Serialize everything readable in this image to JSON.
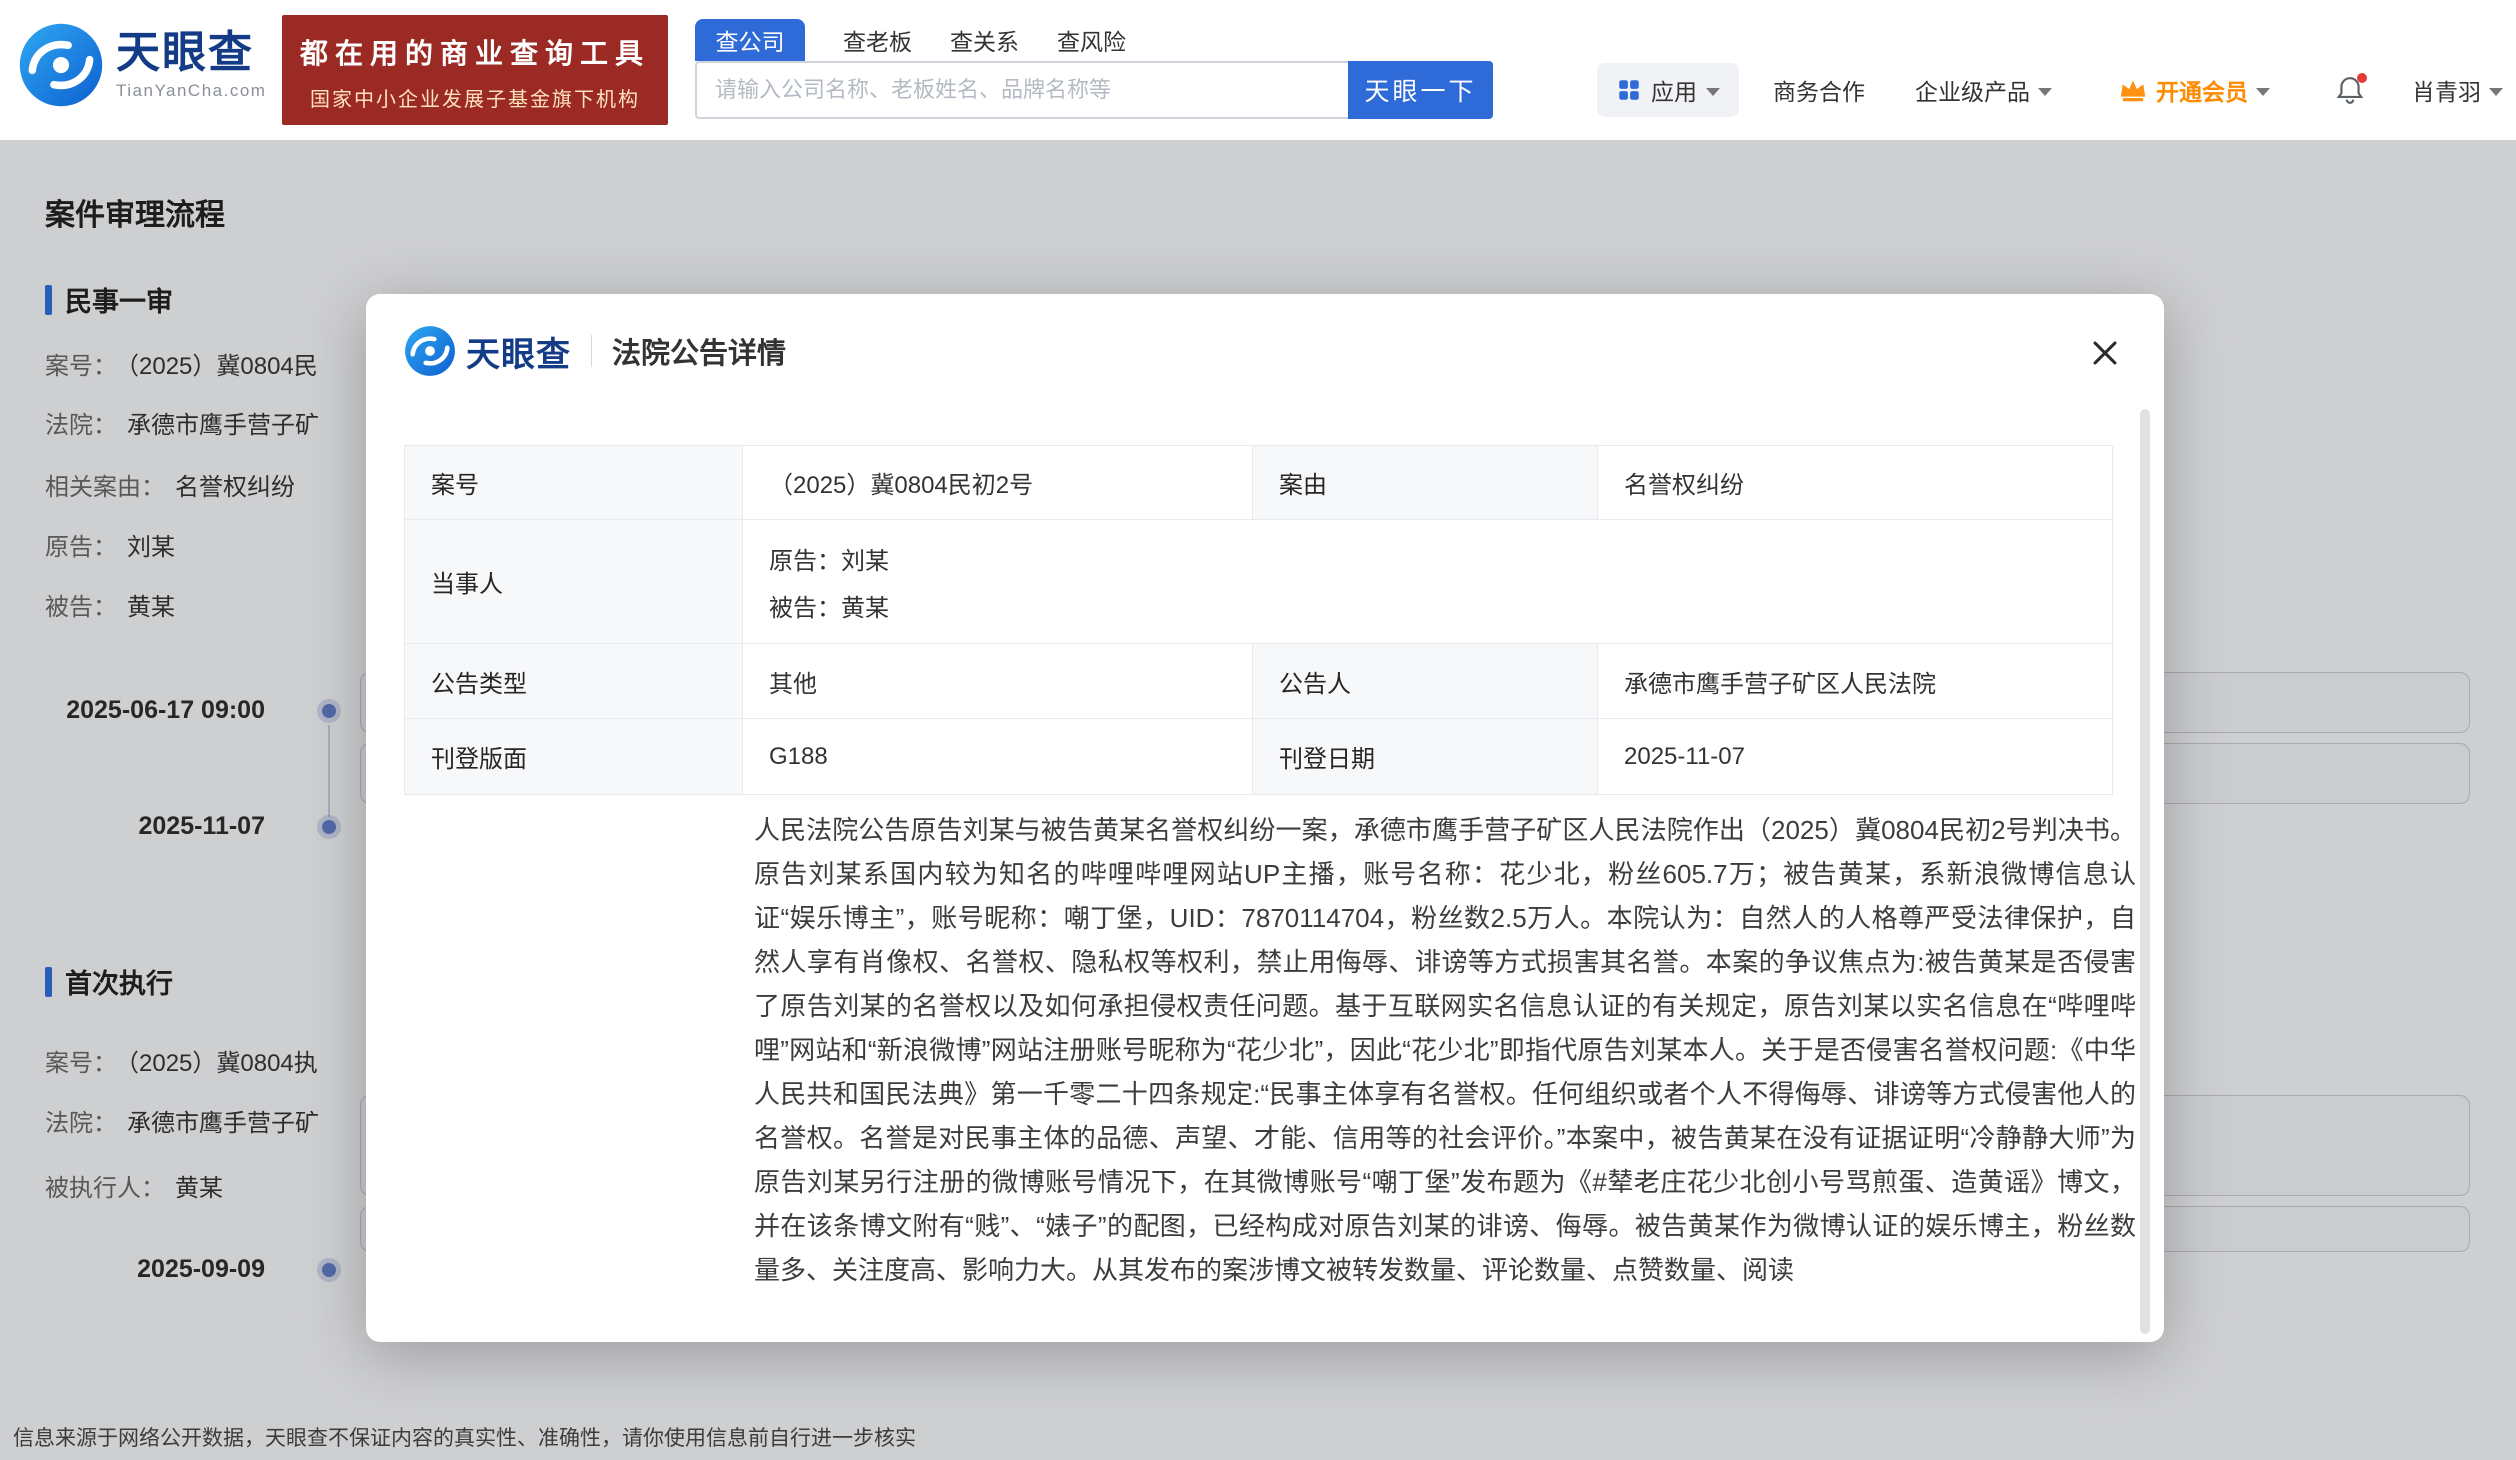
{
  "colors": {
    "brand_blue": "#2f6bd8",
    "vip_orange": "#ff8a00",
    "banner_red": "#9c2a24",
    "navy": "#143c86"
  },
  "nav": {
    "brand": "天眼查",
    "brand_domain": "TianYanCha.com",
    "banner_line1": "都在用的商业查询工具",
    "banner_line2": "国家中小企业发展子基金旗下机构",
    "tabs": [
      {
        "label": "查公司"
      },
      {
        "label": "查老板"
      },
      {
        "label": "查关系"
      },
      {
        "label": "查风险"
      }
    ],
    "search_placeholder": "请输入公司名称、老板姓名、品牌名称等",
    "search_button": "天眼一下",
    "apps": "应用",
    "business": "商务合作",
    "enterprise": "企业级产品",
    "vip": "开通会员",
    "username": "肖青羽"
  },
  "page": {
    "title": "案件审理流程",
    "sections": [
      {
        "title": "民事一审",
        "fields": [
          {
            "label": "案号：",
            "value": "（2025）冀0804民"
          },
          {
            "label": "法院：",
            "value": "承德市鹰手营子矿"
          },
          {
            "label": "相关案由：",
            "value": "名誉权纠纷"
          },
          {
            "label": "原告：",
            "value": "刘某"
          },
          {
            "label": "被告：",
            "value": "黄某"
          }
        ],
        "timeline": [
          "2025-06-17 09:00",
          "2025-11-07"
        ]
      },
      {
        "title": "首次执行",
        "fields": [
          {
            "label": "案号：",
            "value": "（2025）冀0804执"
          },
          {
            "label": "法院：",
            "value": "承德市鹰手营子矿"
          },
          {
            "label": "被执行人：",
            "value": "黄某"
          }
        ],
        "timeline": [
          "2025-09-09"
        ]
      }
    ],
    "footer": "信息来源于网络公开数据，天眼查不保证内容的真实性、准确性，请你使用信息前自行进一步核实"
  },
  "modal": {
    "brand": "天眼查",
    "title": "法院公告详情",
    "table": {
      "case_no_label": "案号",
      "case_no": "（2025）冀0804民初2号",
      "cause_label": "案由",
      "cause": "名誉权纠纷",
      "party_label": "当事人",
      "party_plaintiff": "原告：刘某",
      "party_defendant": "被告：黄某",
      "type_label": "公告类型",
      "type_value": "其他",
      "announcer_label": "公告人",
      "announcer": "承德市鹰手营子矿区人民法院",
      "layout_label": "刊登版面",
      "layout_value": "G188",
      "date_label": "刊登日期",
      "date_value": "2025-11-07"
    },
    "body": "人民法院公告原告刘某与被告黄某名誉权纠纷一案，承德市鹰手营子矿区人民法院作出（2025）冀0804民初2号判决书。原告刘某系国内较为知名的哔哩哔哩网站UP主播，账号名称：花少北，粉丝605.7万；被告黄某，系新浪微博信息认证“娱乐博主”，账号昵称：嘲丁堡，UID：7870114704，粉丝数2.5万人。本院认为：自然人的人格尊严受法律保护，自然人享有肖像权、名誉权、隐私权等权利，禁止用侮辱、诽谤等方式损害其名誉。本案的争议焦点为:被告黄某是否侵害了原告刘某的名誉权以及如何承担侵权责任问题。基于互联网实名信息认证的有关规定，原告刘某以实名信息在“哔哩哔哩”网站和“新浪微博”网站注册账号昵称为“花少北”，因此“花少北”即指代原告刘某本人。关于是否侵害名誉权问题:《中华人民共和国民法典》第一千零二十四条规定:“民事主体享有名誉权。任何组织或者个人不得侮辱、诽谤等方式侵害他人的名誉权。名誉是对民事主体的品德、声望、才能、信用等的社会评价。”本案中，被告黄某在没有证据证明“冷静静大师”为原告刘某另行注册的微博账号情况下，在其微博账号“嘲丁堡”发布题为《#辇老庄花少北创小号骂煎蛋、造黄谣》博文，并在该条博文附有“贱”、“婊子”的配图，已经构成对原告刘某的诽谤、侮辱。被告黄某作为微博认证的娱乐博主，粉丝数量多、关注度高、影响力大。从其发布的案涉博文被转发数量、评论数量、点赞数量、阅读"
  }
}
